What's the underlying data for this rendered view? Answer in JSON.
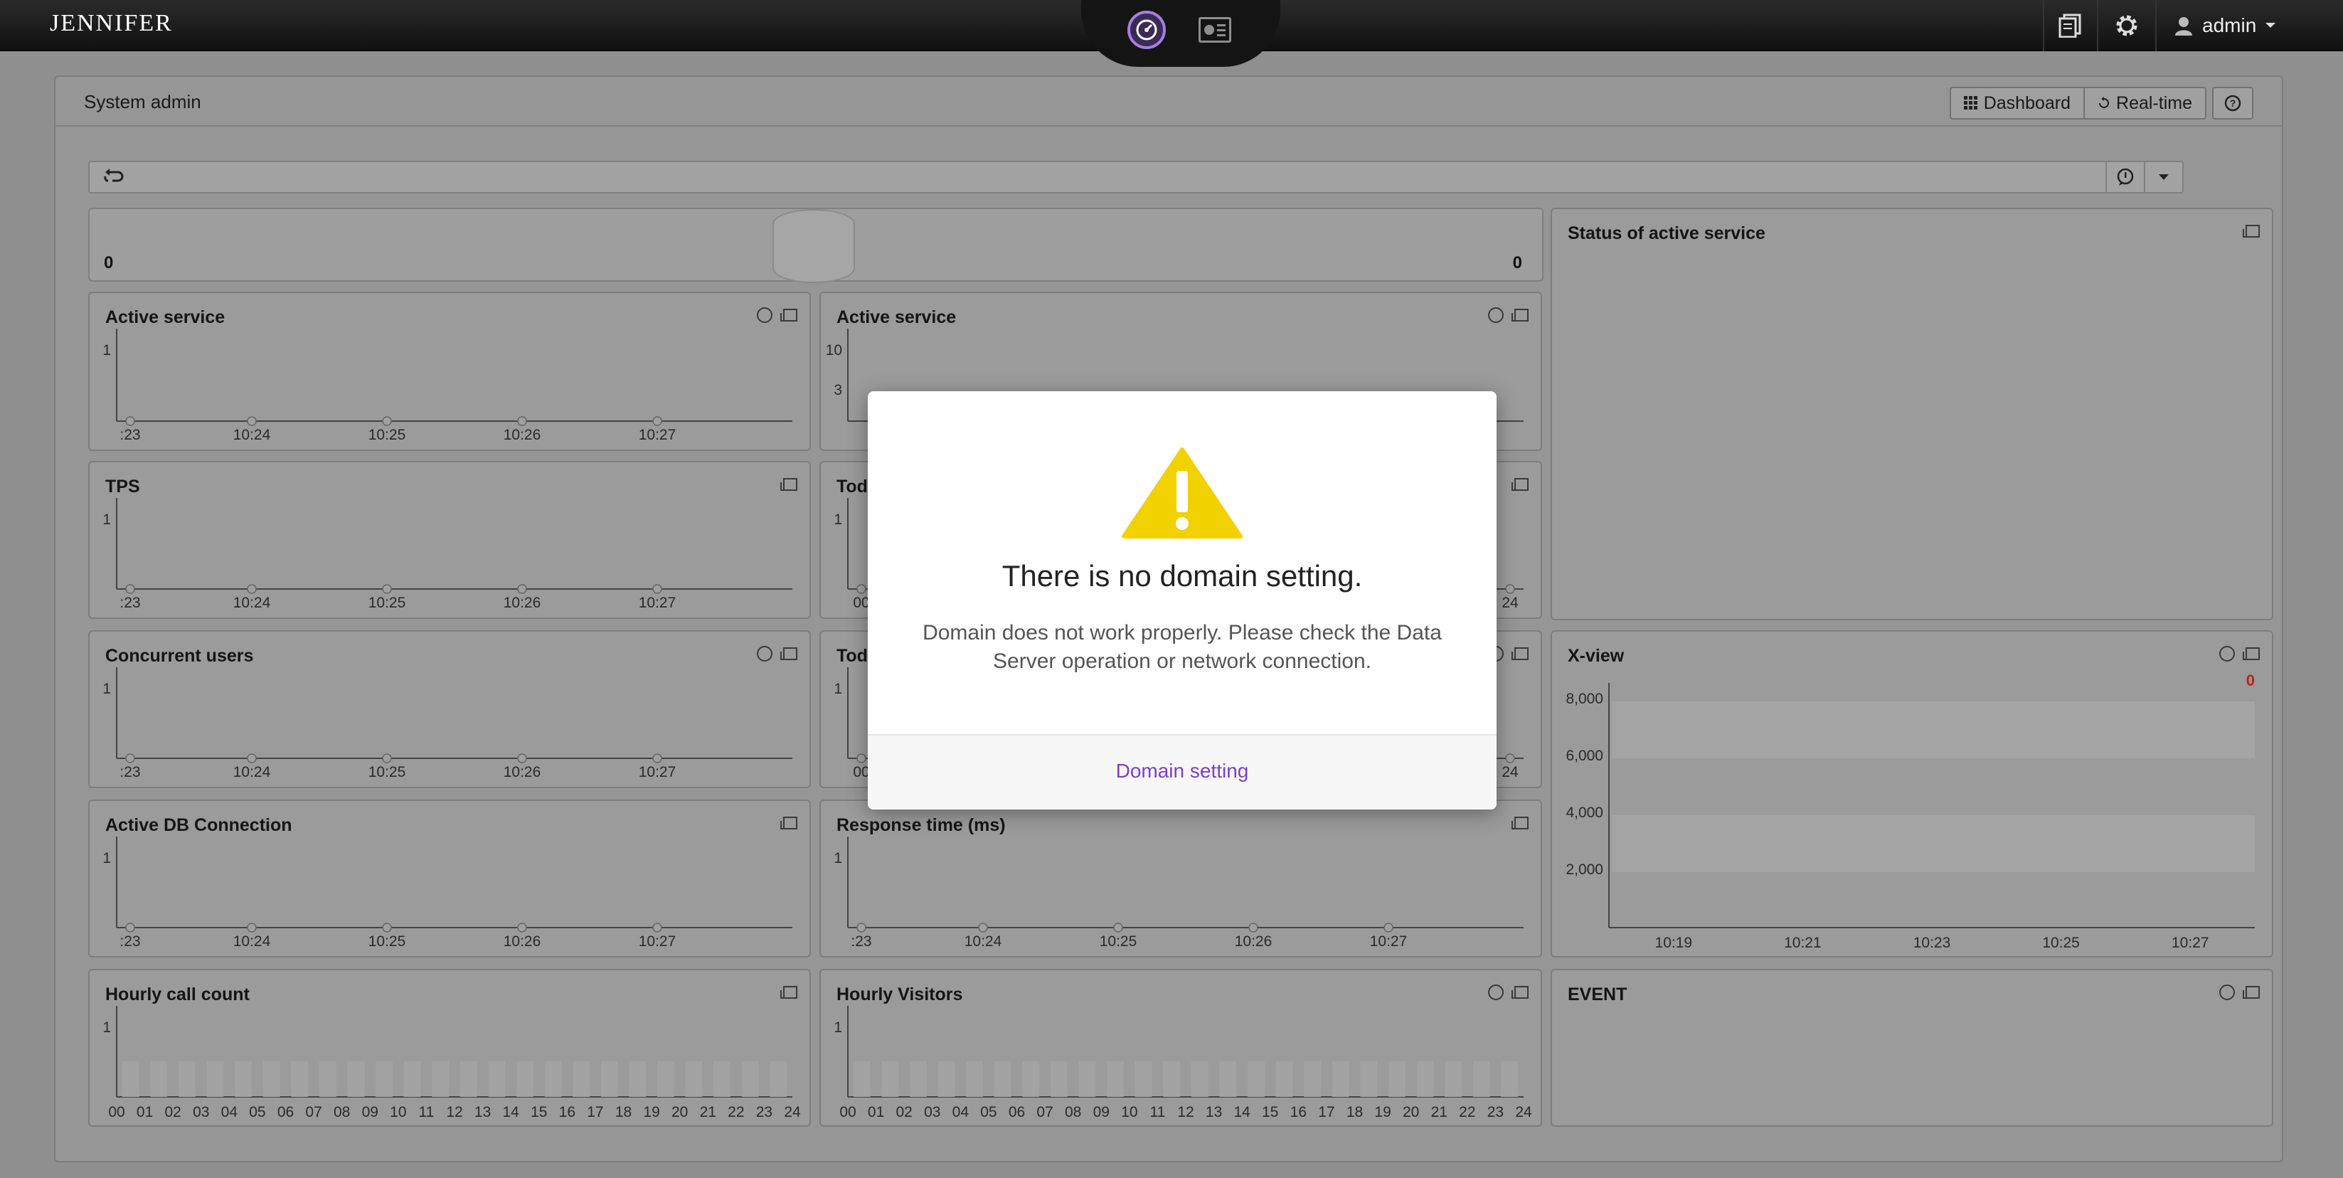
{
  "app": {
    "logo": "JENNIFER",
    "user": "admin"
  },
  "page": {
    "title": "System admin",
    "buttons": {
      "dashboard": "Dashboard",
      "realtime": "Real-time"
    }
  },
  "speedometer": {
    "left_value": "0",
    "right_value": "0"
  },
  "widgets": {
    "active_service_1": {
      "title": "Active service",
      "ylabels": [
        "1"
      ],
      "xlabels": [
        ":23",
        "10:24",
        "10:25",
        "10:26",
        "10:27"
      ]
    },
    "active_service_2": {
      "title": "Active service",
      "ylabels": [
        "10",
        "3"
      ]
    },
    "tps": {
      "title": "TPS",
      "ylabels": [
        "1"
      ],
      "xlabels": [
        ":23",
        "10:24",
        "10:25",
        "10:26",
        "10:27"
      ]
    },
    "today_1": {
      "title": "Tod",
      "ylabels": [
        "1"
      ],
      "xlabels": [
        "00",
        "24"
      ]
    },
    "concurrent_users": {
      "title": "Concurrent users",
      "ylabels": [
        "1"
      ],
      "xlabels": [
        ":23",
        "10:24",
        "10:25",
        "10:26",
        "10:27"
      ]
    },
    "today_2": {
      "title": "Tod",
      "ylabels": [
        "1"
      ],
      "xlabels": [
        "00",
        "24"
      ]
    },
    "active_db": {
      "title": "Active DB Connection",
      "ylabels": [
        "1"
      ],
      "xlabels": [
        ":23",
        "10:24",
        "10:25",
        "10:26",
        "10:27"
      ]
    },
    "response_time": {
      "title": "Response time (ms)",
      "ylabels": [
        "1"
      ],
      "xlabels": [
        ":23",
        "10:24",
        "10:25",
        "10:26",
        "10:27"
      ]
    },
    "hourly_call": {
      "title": "Hourly call count",
      "ylabels": [
        "1"
      ],
      "xlabels": [
        "00",
        "01",
        "02",
        "03",
        "04",
        "05",
        "06",
        "07",
        "08",
        "09",
        "10",
        "11",
        "12",
        "13",
        "14",
        "15",
        "16",
        "17",
        "18",
        "19",
        "20",
        "21",
        "22",
        "23",
        "24"
      ]
    },
    "hourly_visitors": {
      "title": "Hourly Visitors",
      "ylabels": [
        "1"
      ],
      "xlabels": [
        "00",
        "01",
        "02",
        "03",
        "04",
        "05",
        "06",
        "07",
        "08",
        "09",
        "10",
        "11",
        "12",
        "13",
        "14",
        "15",
        "16",
        "17",
        "18",
        "19",
        "20",
        "21",
        "22",
        "23",
        "24"
      ]
    },
    "status_active": {
      "title": "Status of active service"
    },
    "xview": {
      "title": "X-view",
      "count": "0",
      "ylabels": [
        "8,000",
        "6,000",
        "4,000",
        "2,000"
      ],
      "xlabels": [
        "10:19",
        "10:21",
        "10:23",
        "10:25",
        "10:27"
      ]
    },
    "event": {
      "title": "EVENT"
    }
  },
  "modal": {
    "title": "There is no domain setting.",
    "message": "Domain does not work properly. Please check the Data Server operation or network connection.",
    "link": "Domain setting"
  },
  "colors": {
    "accent": "#7b40c4",
    "warning": "#f2d100",
    "xview_count": "#c0221a"
  }
}
